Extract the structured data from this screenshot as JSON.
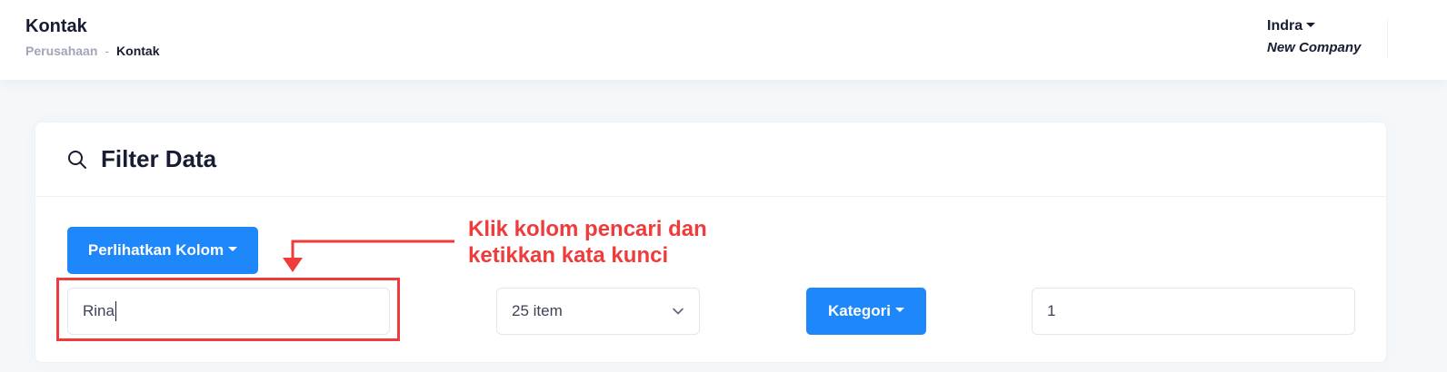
{
  "header": {
    "title": "Kontak",
    "breadcrumb": {
      "parent": "Perusahaan",
      "separator": "-",
      "current": "Kontak"
    },
    "user": {
      "name": "Indra",
      "company": "New Company"
    }
  },
  "filter": {
    "title": "Filter Data",
    "icon": "search-icon",
    "show_columns_label": "Perlihatkan Kolom",
    "search_value": "Rina",
    "page_size": "25 item",
    "category_label": "Kategori",
    "page_number": "1"
  },
  "annotation": {
    "line1": "Klik kolom pencari dan",
    "line2": "ketikkan kata kunci",
    "color": "#ef3b3b"
  },
  "colors": {
    "primary": "#1e88fb",
    "text": "#181c32",
    "muted": "#a1a5b7"
  }
}
